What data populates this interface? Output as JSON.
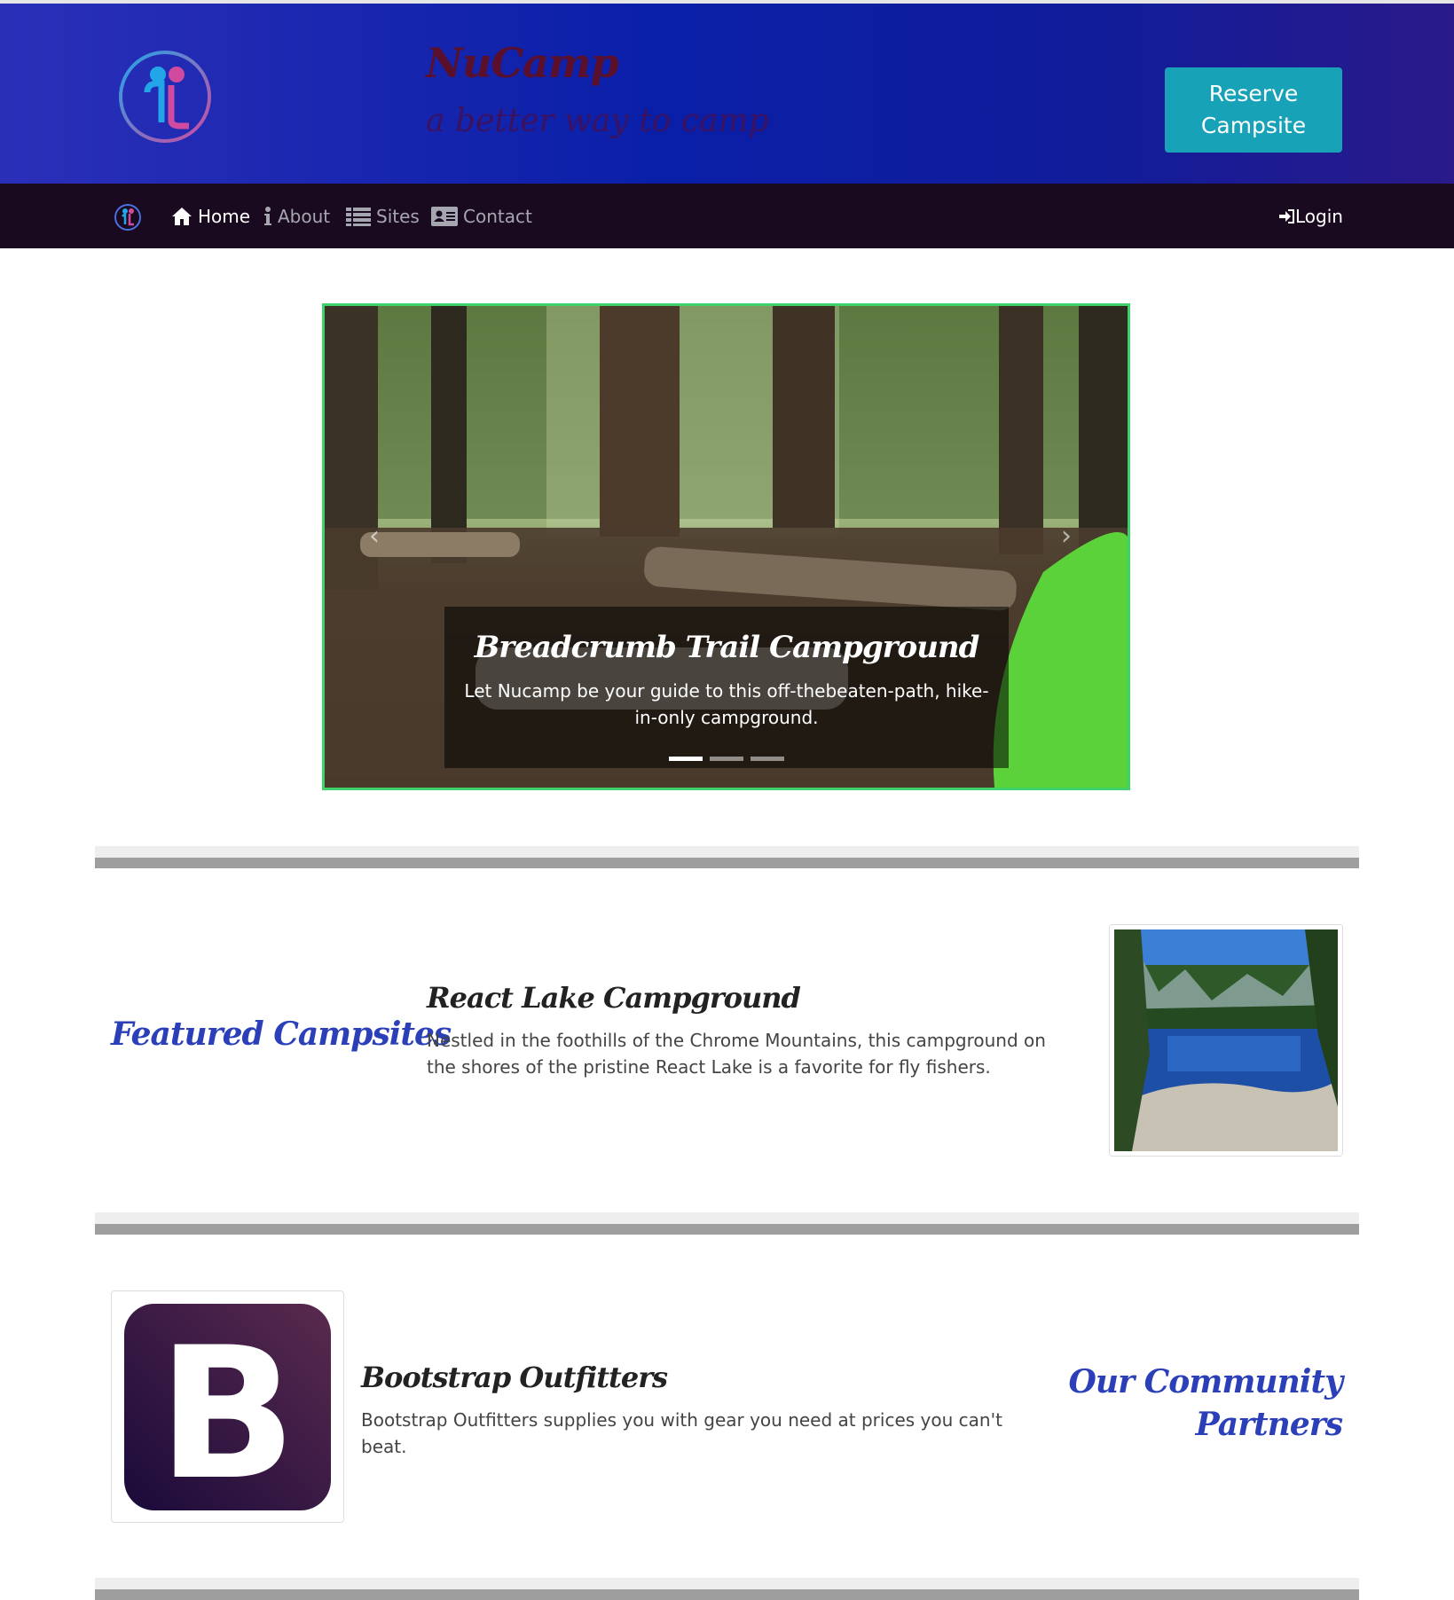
{
  "header": {
    "brand_title": "NuCamp",
    "tagline": "a better way to camp",
    "reserve_button": "Reserve Campsite"
  },
  "nav": {
    "items": [
      {
        "label": "Home",
        "icon": "home-icon",
        "active": true
      },
      {
        "label": "About",
        "icon": "info-icon",
        "active": false
      },
      {
        "label": "Sites",
        "icon": "list-icon",
        "active": false
      },
      {
        "label": "Contact",
        "icon": "address-card-icon",
        "active": false
      }
    ],
    "login": "Login"
  },
  "carousel": {
    "title": "Breadcrumb Trail Campground",
    "text": "Let Nucamp be your guide to this off-thebeaten-path, hike-in-only campground.",
    "slides": 3,
    "active_slide": 1
  },
  "featured": {
    "heading": "Featured Campsites",
    "title": "React Lake Campground",
    "text": "Nestled in the foothills of the Chrome Mountains, this campground on the shores of the pristine React Lake is a favorite for fly fishers."
  },
  "partners": {
    "heading_line1": "Our Community",
    "heading_line2": "Partners",
    "title": "Bootstrap Outfitters",
    "text": "Bootstrap Outfitters supplies you with gear you need at prices you can't beat.",
    "logo_letter": "B"
  },
  "colors": {
    "accent_button": "#17a2b8",
    "heading_blue": "#2b3fb8",
    "carousel_border": "#3fd26b"
  }
}
